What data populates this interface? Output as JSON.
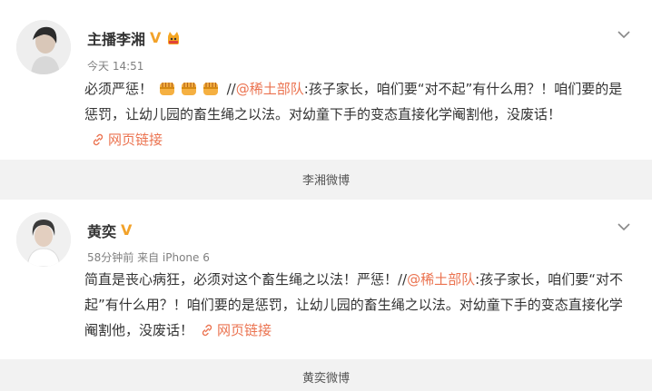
{
  "post1": {
    "author": "主播李湘",
    "time": "今天 14:51",
    "text_before": "必须严惩！",
    "text_sep": " //",
    "mention": "@稀土部队",
    "text_after": ":孩子家长，咱们要“对不起”有什么用？！咱们要的是惩罚，让幼儿园的畜生绳之以法。对幼童下手的变态直接化学阉割他，没废话！",
    "link_label": "网页链接",
    "caption": "李湘微博"
  },
  "post2": {
    "author": "黄奕",
    "meta": "58分钟前 来自 iPhone 6",
    "text_before": "简直是丧心病狂，必须对这个畜生绳之以法！严惩！//",
    "mention": "@稀土部队",
    "text_after": ":孩子家长，咱们要“对不起”有什么用？！咱们要的是惩罚，让幼儿园的畜生绳之以法。对幼童下手的变态直接化学阉割他，没废话！",
    "link_label": "网页链接",
    "caption": "黄奕微博"
  },
  "colors": {
    "accent": "#eb7350",
    "verified": "#f2a22a",
    "background": "#f2f2f2"
  },
  "icons": [
    "chevron-down-icon",
    "verified-badge-icon",
    "fist-emoji-icon",
    "link-icon"
  ]
}
